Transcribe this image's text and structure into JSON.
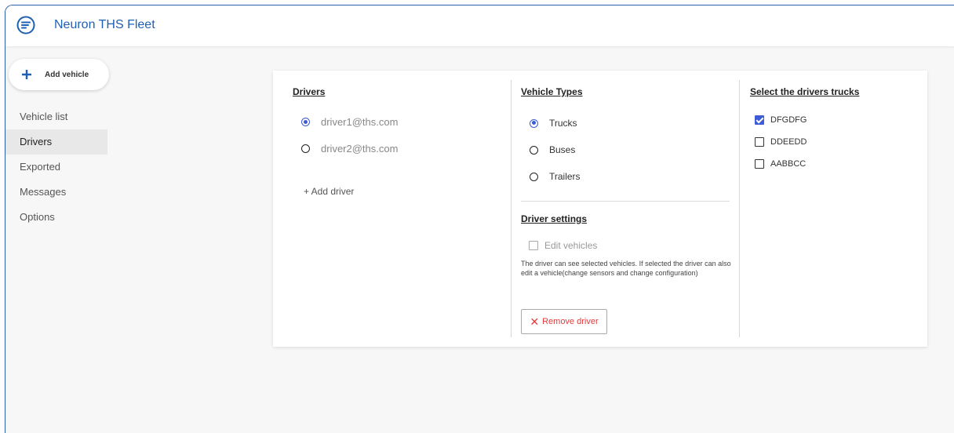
{
  "app": {
    "title": "Neuron THS Fleet",
    "logo_icon": "menu-lines-icon"
  },
  "sidebar": {
    "add_vehicle_label": "Add vehicle",
    "items": [
      {
        "label": "Vehicle list",
        "active": false
      },
      {
        "label": "Drivers",
        "active": true
      },
      {
        "label": "Exported",
        "active": false
      },
      {
        "label": "Messages",
        "active": false
      },
      {
        "label": "Options",
        "active": false
      }
    ]
  },
  "drivers": {
    "title": "Drivers",
    "list": [
      {
        "email": "driver1@ths.com",
        "selected": true
      },
      {
        "email": "driver2@ths.com",
        "selected": false
      }
    ],
    "add_label": "+ Add driver"
  },
  "vehicle_types": {
    "title": "Vehicle Types",
    "options": [
      {
        "label": "Trucks",
        "selected": true
      },
      {
        "label": "Buses",
        "selected": false
      },
      {
        "label": "Trailers",
        "selected": false
      }
    ]
  },
  "driver_settings": {
    "title": "Driver settings",
    "edit_vehicles_label": "Edit vehicles",
    "edit_vehicles_checked": false,
    "description": "The driver can see selected vehicles. If selected the driver can also edit a vehicle(change sensors and change configuration)",
    "remove_label": "Remove driver"
  },
  "trucks": {
    "title": "Select the drivers trucks",
    "items": [
      {
        "label": "DFGDFG",
        "checked": true
      },
      {
        "label": "DDEEDD",
        "checked": false
      },
      {
        "label": "AABBCC",
        "checked": false
      }
    ]
  },
  "colors": {
    "brand": "#1f5fb4",
    "accent": "#3d5bd4",
    "danger": "#e23b3b"
  }
}
